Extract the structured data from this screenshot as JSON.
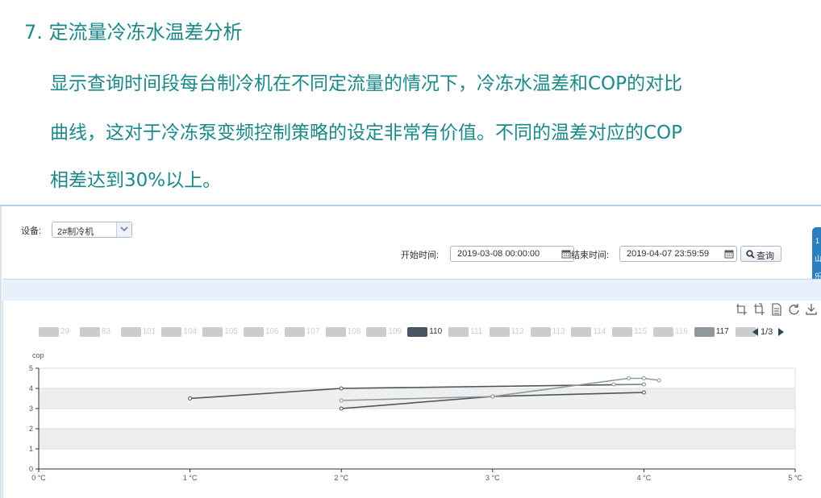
{
  "slide": {
    "heading": "7. 定流量冷冻水温差分析",
    "para_lines": [
      "显示查询时间段每台制冷机在不同定流量的情况下，冷冻水温差和COP的对比",
      "曲线，这对于冷冻泵变频控制策略的设定非常有价值。不同的温差对应的COP",
      "相差达到30%以上。"
    ]
  },
  "app": {
    "device_label": "设备:",
    "device_value": "2#制冷机",
    "start_label": "开始时间:",
    "start_value": "2019-03-08 00:00:00",
    "end_label": "结束时间:",
    "end_value": "2019-04-07 23:59:59",
    "query_label": "查询",
    "side_tab_chars": [
      "1",
      "山",
      "乐"
    ]
  },
  "toolbox_icons": [
    "data-zoom-icon",
    "zoom-reset-icon",
    "data-view-icon",
    "restore-icon",
    "save-image-icon"
  ],
  "legend": {
    "items": [
      {
        "label": "29",
        "active": false
      },
      {
        "label": "83",
        "active": false
      },
      {
        "label": "101",
        "active": false
      },
      {
        "label": "104",
        "active": false
      },
      {
        "label": "105",
        "active": false
      },
      {
        "label": "106",
        "active": false
      },
      {
        "label": "107",
        "active": false
      },
      {
        "label": "108",
        "active": false
      },
      {
        "label": "109",
        "active": false
      },
      {
        "label": "110",
        "active": true,
        "color": "#4a5563"
      },
      {
        "label": "111",
        "active": false
      },
      {
        "label": "112",
        "active": false
      },
      {
        "label": "113",
        "active": false
      },
      {
        "label": "114",
        "active": false
      },
      {
        "label": "115",
        "active": false
      },
      {
        "label": "116",
        "active": false
      },
      {
        "label": "117",
        "active": true,
        "color": "#8e9a99"
      },
      {
        "label": "",
        "active": false
      }
    ],
    "inactive_color": "#cccccc",
    "page": "1/3"
  },
  "chart_data": {
    "type": "line",
    "ylabel": "cop",
    "xlim": [
      0,
      5
    ],
    "ylim": [
      0,
      5
    ],
    "x_ticks": [
      "0 °C",
      "1 °C",
      "2 °C",
      "3 °C",
      "4 °C",
      "5 °C"
    ],
    "y_ticks": [
      "0",
      "1",
      "2",
      "3",
      "4",
      "5"
    ],
    "grid": true,
    "series": [
      {
        "name": "110",
        "color": "#4a5563",
        "points": [
          [
            1.0,
            3.5
          ],
          [
            2.0,
            4.0
          ],
          [
            4.0,
            4.2
          ]
        ]
      },
      {
        "name": "110",
        "color": "#4a5563",
        "points": [
          [
            2.0,
            3.0
          ],
          [
            3.0,
            3.6
          ],
          [
            4.0,
            3.8
          ]
        ]
      },
      {
        "name": "117",
        "color": "#8e9a99",
        "points": [
          [
            2.0,
            3.4
          ],
          [
            3.0,
            3.6
          ],
          [
            3.9,
            4.5
          ],
          [
            4.0,
            4.5
          ],
          [
            4.1,
            4.4
          ]
        ]
      },
      {
        "name": "117",
        "color": "#8e9a99",
        "points": [
          [
            3.8,
            4.2
          ],
          [
            4.0,
            4.2
          ]
        ]
      }
    ]
  }
}
